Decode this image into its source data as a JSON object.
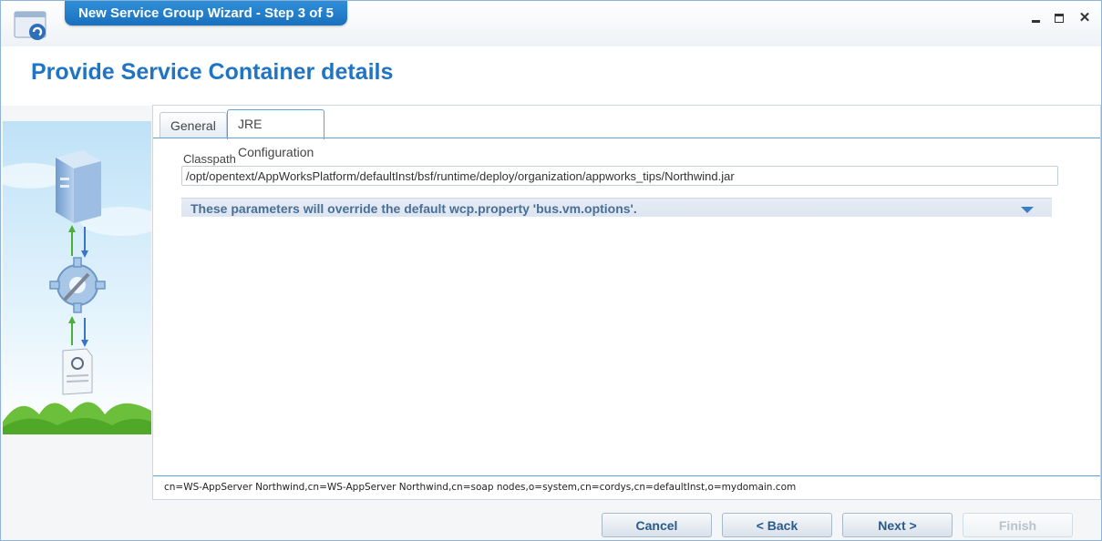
{
  "window": {
    "title": "New Service Group Wizard - Step 3 of 5"
  },
  "header": {
    "title": "Provide Service Container details"
  },
  "tabs": [
    {
      "label": "General",
      "active": false
    },
    {
      "label": "JRE Configuration",
      "active": true
    }
  ],
  "form": {
    "classpath_label": "Classpath",
    "classpath_value": "/opt/opentext/AppWorksPlatform/defaultInst/bsf/runtime/deploy/organization/appworks_tips/Northwind.jar",
    "params_title": "These parameters will override the default wcp.property 'bus.vm.options'."
  },
  "status": {
    "dn": "cn=WS-AppServer Northwind,cn=WS-AppServer Northwind,cn=soap nodes,o=system,cn=cordys,cn=defaultInst,o=mydomain.com"
  },
  "footer": {
    "cancel": "Cancel",
    "back": "< Back",
    "next": "Next >",
    "finish": "Finish"
  },
  "colors": {
    "accent": "#1f75c4",
    "title_bar": "#1a70bd",
    "tab_border": "#5ba3db"
  }
}
